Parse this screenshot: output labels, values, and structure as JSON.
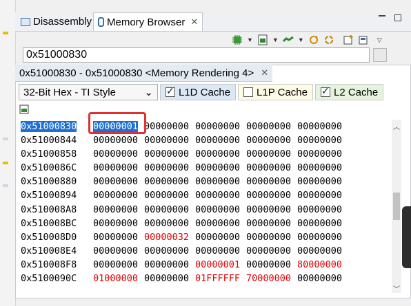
{
  "tabs": [
    {
      "label": "Disassembly"
    },
    {
      "label": "Memory Browser"
    }
  ],
  "address_input": {
    "value": "0x51000830"
  },
  "rendering_tab": {
    "label": "0x51000830 - 0x51000830  <Memory Rendering 4>"
  },
  "format_select": {
    "value": "32-Bit Hex - TI Style"
  },
  "cache_options": [
    {
      "label": "L1D Cache",
      "checked": true
    },
    {
      "label": "L1P Cache",
      "checked": false
    },
    {
      "label": "L2 Cache",
      "checked": true
    }
  ],
  "memory_rows": [
    {
      "address": "0x51000830",
      "values": [
        "00000001",
        "00000000",
        "00000000",
        "00000000",
        "00000000"
      ]
    },
    {
      "address": "0x51000844",
      "values": [
        "00000000",
        "00000000",
        "00000000",
        "00000000",
        "00000000"
      ]
    },
    {
      "address": "0x51000858",
      "values": [
        "00000000",
        "00000000",
        "00000000",
        "00000000",
        "00000000"
      ]
    },
    {
      "address": "0x5100086C",
      "values": [
        "00000000",
        "00000000",
        "00000000",
        "00000000",
        "00000000"
      ]
    },
    {
      "address": "0x51000880",
      "values": [
        "00000000",
        "00000000",
        "00000000",
        "00000000",
        "00000000"
      ]
    },
    {
      "address": "0x51000894",
      "values": [
        "00000000",
        "00000000",
        "00000000",
        "00000000",
        "00000000"
      ]
    },
    {
      "address": "0x510008A8",
      "values": [
        "00000000",
        "00000000",
        "00000000",
        "00000000",
        "00000000"
      ]
    },
    {
      "address": "0x510008BC",
      "values": [
        "00000000",
        "00000000",
        "00000000",
        "00000000",
        "00000000"
      ]
    },
    {
      "address": "0x510008D0",
      "values": [
        "00000000",
        "00000032",
        "00000000",
        "00000000",
        "00000000"
      ]
    },
    {
      "address": "0x510008E4",
      "values": [
        "00000000",
        "00000000",
        "00000000",
        "00000000",
        "00000000"
      ]
    },
    {
      "address": "0x510008F8",
      "values": [
        "00000000",
        "00000000",
        "00000001",
        "00000000",
        "80000000"
      ]
    },
    {
      "address": "0x5100090C",
      "values": [
        "01000000",
        "00000000",
        "01FFFFFF",
        "70000000",
        "00000000"
      ]
    }
  ],
  "colors": {
    "selection": "#1e6fd1",
    "changed_value": "#e00000",
    "highlight_box": "#e03030"
  },
  "icons": [
    "disassembly-icon",
    "memory-browser-icon",
    "chip-icon",
    "memory-icon",
    "connect-icon",
    "sync-icon",
    "new-view-icon",
    "pin-icon"
  ]
}
